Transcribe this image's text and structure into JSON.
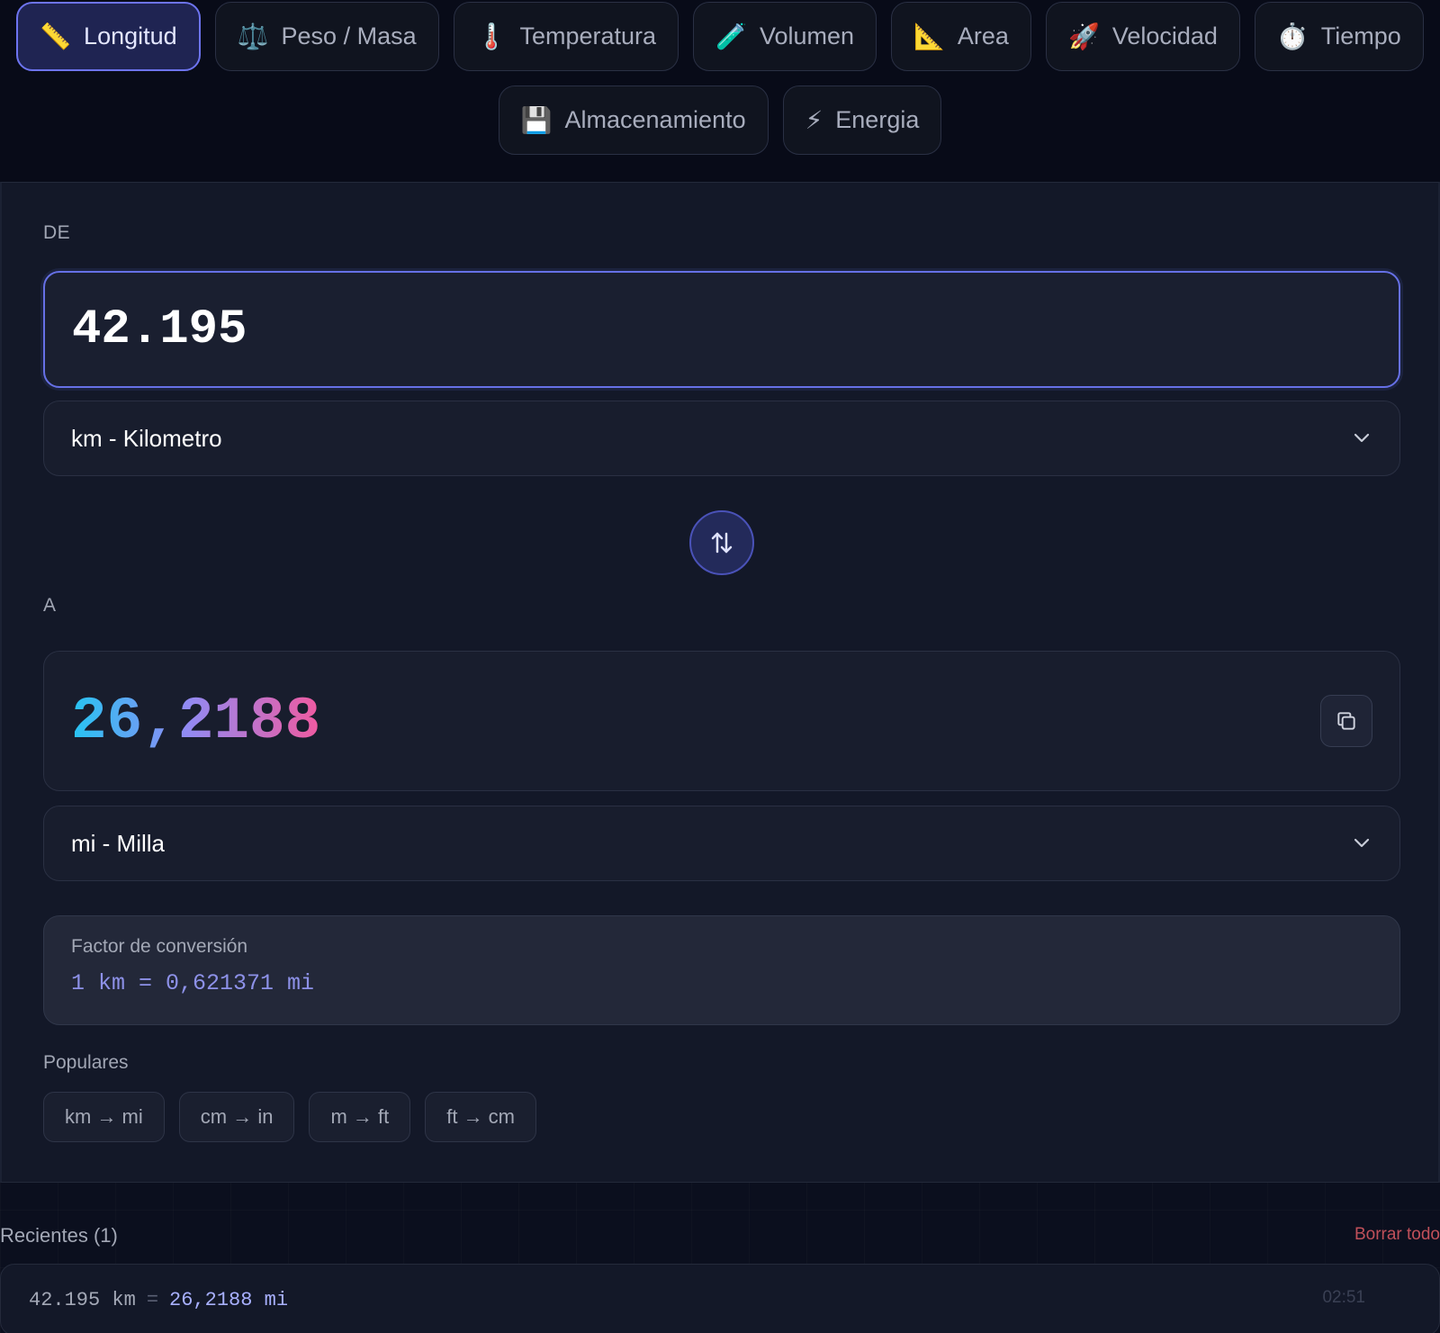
{
  "categories": [
    {
      "icon": "📏",
      "label": "Longitud",
      "active": true
    },
    {
      "icon": "⚖️",
      "label": "Peso / Masa",
      "active": false
    },
    {
      "icon": "🌡️",
      "label": "Temperatura",
      "active": false
    },
    {
      "icon": "🧪",
      "label": "Volumen",
      "active": false
    },
    {
      "icon": "📐",
      "label": "Area",
      "active": false
    },
    {
      "icon": "🚀",
      "label": "Velocidad",
      "active": false
    },
    {
      "icon": "⏱️",
      "label": "Tiempo",
      "active": false
    },
    {
      "icon": "💾",
      "label": "Almacenamiento",
      "active": false
    },
    {
      "icon": "⚡",
      "label": "Energia",
      "active": false
    }
  ],
  "converter": {
    "from_label": "DE",
    "from_value": "42.195",
    "from_unit": "km - Kilometro",
    "to_label": "A",
    "to_value": "26,2188",
    "to_unit": "mi - Milla",
    "factor_title": "Factor de conversión",
    "factor_value": "1 km = 0,621371 mi"
  },
  "popular": {
    "label": "Populares",
    "items": [
      "km → mi",
      "cm → in",
      "m → ft",
      "ft → cm"
    ]
  },
  "recent": {
    "label": "Recientes (1)",
    "clear_label": "Borrar todo",
    "items": [
      {
        "from": "42.195 km",
        "equals": "=",
        "to": "26,2188 mi",
        "time": "02:51"
      }
    ]
  },
  "colors": {
    "accent": "#6d74f0",
    "danger": "#c0505a",
    "result_gradient": [
      "#26c4f2",
      "#8f8cf5",
      "#f05aa0"
    ]
  }
}
